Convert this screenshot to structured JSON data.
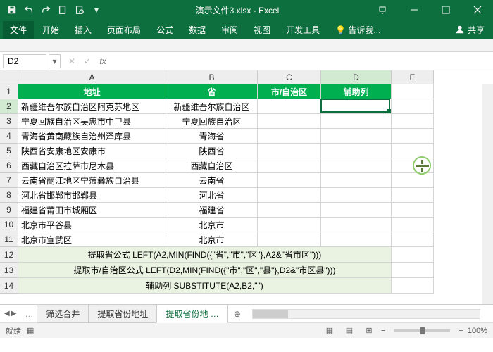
{
  "title": "演示文件3.xlsx - Excel",
  "menu": {
    "file": "文件",
    "home": "开始",
    "insert": "插入",
    "layout": "页面布局",
    "formula": "公式",
    "data": "数据",
    "review": "审阅",
    "view": "视图",
    "dev": "开发工具",
    "tell": "告诉我...",
    "share": "共享"
  },
  "name_box": "D2",
  "cols": {
    "A": 210,
    "B": 130,
    "C": 90,
    "D": 100,
    "E": 60
  },
  "row_heights": {
    "normal": 21,
    "note": 22
  },
  "headers": {
    "A": "地址",
    "B": "省",
    "C": "市/自治区",
    "D": "辅助列"
  },
  "data_rows": [
    {
      "A": "新疆维吾尔族自治区阿克苏地区",
      "B": "新疆维吾尔族自治区"
    },
    {
      "A": "宁夏回族自治区吴忠市中卫县",
      "B": "宁夏回族自治区"
    },
    {
      "A": "青海省黄南藏族自治州泽库县",
      "B": "青海省"
    },
    {
      "A": "陕西省安康地区安康市",
      "B": "陕西省"
    },
    {
      "A": "西藏自治区拉萨市尼木县",
      "B": "西藏自治区"
    },
    {
      "A": "云南省丽江地区宁蒗彝族自治县",
      "B": "云南省"
    },
    {
      "A": "河北省邯郸市邯郸县",
      "B": "河北省"
    },
    {
      "A": "福建省莆田市城厢区",
      "B": "福建省"
    },
    {
      "A": "北京市平谷县",
      "B": "北京市"
    },
    {
      "A": "北京市宣武区",
      "B": "北京市"
    }
  ],
  "notes": [
    "提取省公式  LEFT(A2,MIN(FIND({\"省\",\"市\",\"区\"},A2&\"省市区\")))",
    "提取市/自治区公式  LEFT(D2,MIN(FIND({\"市\",\"区\",\"县\"},D2&\"市区县\")))",
    "辅助列  SUBSTITUTE(A2,B2,\"\")"
  ],
  "tabs": [
    "筛选合并",
    "提取省份地址",
    "提取省份地"
  ],
  "status": "就绪",
  "zoom": "100%"
}
